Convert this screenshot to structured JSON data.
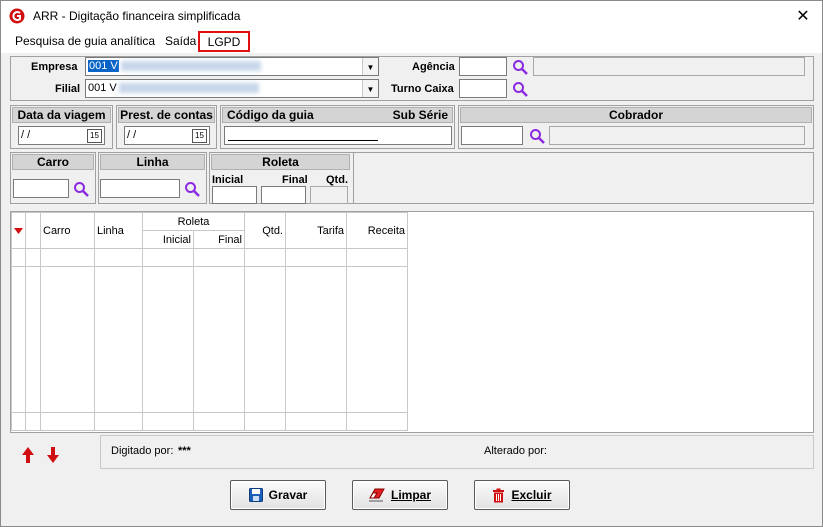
{
  "window": {
    "title": "ARR - Digitação financeira simplificada",
    "close_glyph": "✕"
  },
  "menu": {
    "items": [
      "Pesquisa de guia analítica",
      "Saída",
      "LGPD"
    ]
  },
  "filters": {
    "empresa_label": "Empresa",
    "empresa_value": "001 V",
    "filial_label": "Filial",
    "filial_value": "001 V",
    "agencia_label": "Agência",
    "turno_label": "Turno Caixa"
  },
  "sections": {
    "data_viagem": "Data da viagem",
    "data_viagem_value": "/ /",
    "prest_contas": "Prest. de contas",
    "prest_contas_value": "/ /",
    "codigo_guia": "Código da guia",
    "sub_serie": "Sub Série",
    "cobrador": "Cobrador",
    "carro": "Carro",
    "linha": "Linha",
    "roleta": "Roleta",
    "inicial": "Inicial",
    "final": "Final",
    "qtd": "Qtd.",
    "calendar_glyph": "15"
  },
  "grid": {
    "columns": [
      "Carro",
      "Linha",
      "Roleta",
      "Inicial",
      "Final",
      "Qtd.",
      "Tarifa",
      "Receita"
    ]
  },
  "footer": {
    "digitado_label": "Digitado por:",
    "digitado_value": "***",
    "alterado_label": "Alterado por:"
  },
  "buttons": {
    "gravar": "Gravar",
    "limpar": "Limpar",
    "excluir": "Excluir"
  },
  "colors": {
    "accent_red": "#d01010",
    "search_purple": "#8a2be2",
    "save_blue": "#1c5fb8"
  }
}
